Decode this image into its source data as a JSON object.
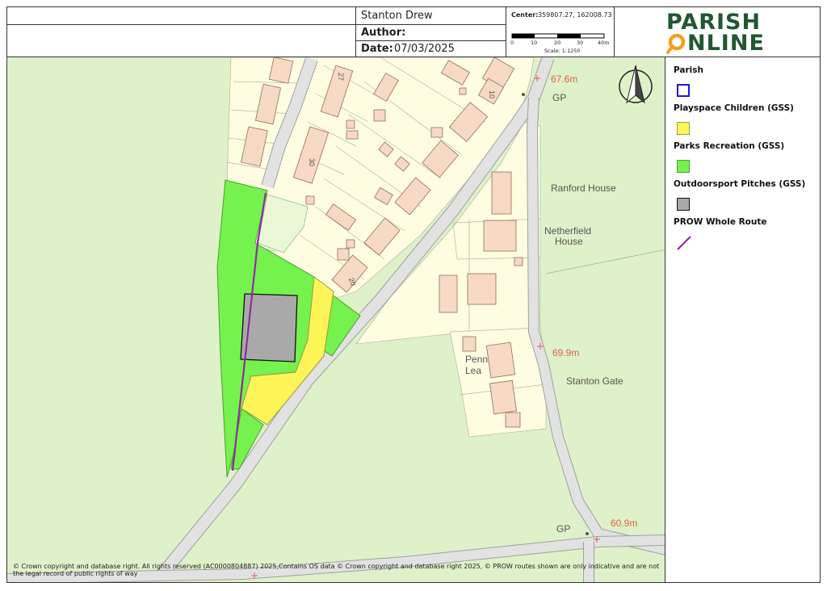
{
  "header": {
    "site_name": "Stanton Drew",
    "author_label": "Author:",
    "date_label": "Date:",
    "date_value": "07/03/2025",
    "center_label": "Center:",
    "center_value": "359807.27, 162008.73",
    "scale_ticks": [
      "0",
      "10",
      "20",
      "30",
      "40m"
    ],
    "scale_text": "Scale: 1:1250",
    "logo_word_top": "PARISH",
    "logo_word_bottom": "NLINE",
    "logo_colors": {
      "green": "#215731",
      "orange": "#f0a020"
    }
  },
  "legend": {
    "items": [
      {
        "label": "Parish",
        "color": "#1a1adb",
        "style": "outline"
      },
      {
        "label": "Playspace Children (GSS)",
        "color": "#fdf558",
        "style": "fill"
      },
      {
        "label": "Parks Recreation (GSS)",
        "color": "#75f24d",
        "style": "fill"
      },
      {
        "label": "Outdoorsport Pitches (GSS)",
        "color": "#a9a9a9",
        "style": "fill"
      },
      {
        "label": "PROW Whole Route",
        "color": "#8b2d9e",
        "style": "line"
      }
    ]
  },
  "map": {
    "labels": {
      "spot_height_1": "67.6m",
      "gp_1": "GP",
      "house_10": "10",
      "house_27": "27",
      "house_30": "30",
      "house_20": "20",
      "ranford": "Ranford House",
      "netherfield_1": "Netherfield",
      "netherfield_2": "House",
      "spot_height_2": "69.9m",
      "penn_1": "Penn",
      "penn_2": "Lea",
      "stanton_gate": "Stanton Gate",
      "gp_2": "GP",
      "spot_height_3": "60.9m"
    },
    "colors": {
      "field": "#dff1c8",
      "residential": "#fefde1",
      "building": "#f8d9c4",
      "road": "#e2e2e2",
      "spot_height": "#e06050"
    }
  },
  "copyright": "© Crown copyright and database right. All rights reserved (AC0000804887) 2025,Contains OS data © Crown copyright and database right 2025, © PROW routes shown are only indicative and are not the legal record of public rights of way"
}
